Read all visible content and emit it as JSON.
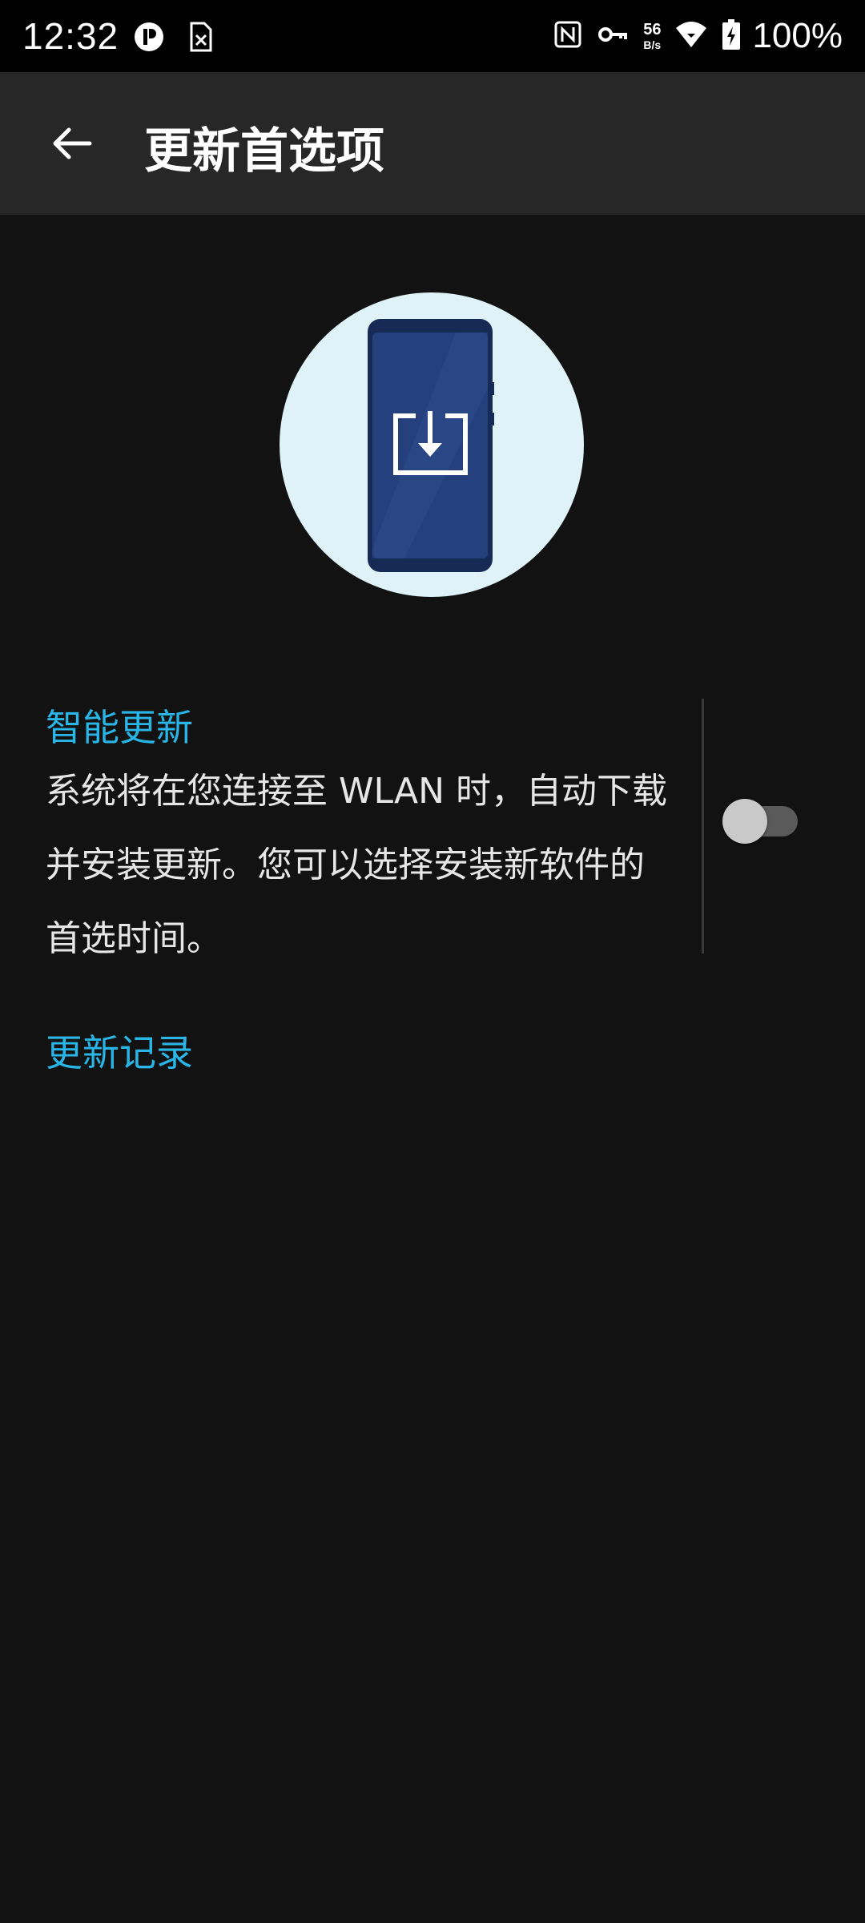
{
  "status_bar": {
    "time": "12:32",
    "net_speed_value": "56",
    "net_speed_unit": "B/s",
    "battery": "100%",
    "left_icons": [
      "media-icon",
      "sim-off-icon"
    ],
    "right_icons": [
      "nfc-icon",
      "vpn-key-icon",
      "wifi-icon",
      "battery-charging-icon"
    ]
  },
  "app_bar": {
    "title": "更新首选项",
    "back_icon": "arrow-back-icon"
  },
  "hero": {
    "icon": "phone-download-illustration"
  },
  "smart_update": {
    "title": "智能更新",
    "summary": "系统将在您连接至 WLAN 时，自动下载并安装更新。您可以选择安装新软件的首选时间。",
    "enabled": false
  },
  "update_history": {
    "label": "更新记录"
  },
  "colors": {
    "accent": "#29b6e6",
    "background": "#121212",
    "app_bar": "#272727",
    "status_bar": "#000000",
    "hero_circle": "#def2f8",
    "phone_body": "#1f3568"
  }
}
